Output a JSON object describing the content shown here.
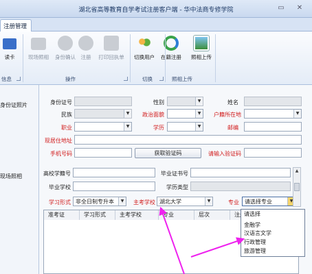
{
  "window": {
    "title": "湖北省高等教育自学考试注册客户端 - 华中法商专修学院",
    "min_glyph": "▭",
    "close_glyph": "✕"
  },
  "tabs": [
    {
      "label": "注册管理"
    }
  ],
  "ribbon": {
    "buttons": [
      {
        "label": "读卡",
        "icon": "id-card-icon",
        "enabled": true
      },
      {
        "label": "现场照相",
        "icon": "camera-icon",
        "enabled": false
      },
      {
        "label": "身份确认",
        "icon": "check-icon",
        "enabled": false
      },
      {
        "label": "注册",
        "icon": "plus-icon",
        "enabled": false
      },
      {
        "label": "打印回执单",
        "icon": "printer-icon",
        "enabled": false
      },
      {
        "label": "切换用户",
        "icon": "users-icon",
        "enabled": true
      },
      {
        "label": "在籍注册",
        "icon": "refresh-icon",
        "enabled": true
      },
      {
        "label": "照相上传",
        "icon": "upload-photo-icon",
        "enabled": true
      }
    ],
    "groups": [
      {
        "label": "信息"
      },
      {
        "label": "操作"
      },
      {
        "label": "切换"
      },
      {
        "label": "照相上传"
      }
    ]
  },
  "left_panel": {
    "id_photo_label": "身份证照片",
    "live_photo_label": "现场照相"
  },
  "form": {
    "id_number": {
      "label": "身份证号",
      "value": ""
    },
    "gender": {
      "label": "性别",
      "value": ""
    },
    "name": {
      "label": "姓名",
      "value": ""
    },
    "ethnicity": {
      "label": "民族",
      "value": ""
    },
    "political_status": {
      "label": "政治面貌",
      "value": ""
    },
    "hukou_location": {
      "label": "户籍所在地",
      "value": ""
    },
    "occupation": {
      "label": "职业",
      "value": ""
    },
    "education": {
      "label": "学历",
      "value": ""
    },
    "postal_code": {
      "label": "邮编",
      "value": ""
    },
    "current_address": {
      "label": "现居住地址",
      "value": ""
    },
    "phone": {
      "label": "手机号码",
      "value": ""
    },
    "get_code_button": {
      "label": "获取验证码"
    },
    "verify_code": {
      "label": "请输入验证码",
      "value": ""
    },
    "college_id": {
      "label": "高校学籍号",
      "value": ""
    },
    "cert_number": {
      "label": "毕业证书号",
      "value": ""
    },
    "school": {
      "label": "毕业学校",
      "value": ""
    },
    "degree_type": {
      "label": "学历类型",
      "value": ""
    },
    "study_form": {
      "label": "学习形式",
      "value": "非全日制专升本"
    },
    "main_school": {
      "label": "主考学校",
      "value": "湖北大学"
    },
    "major": {
      "label": "专业",
      "value": "请选择专业"
    }
  },
  "grid": {
    "columns": [
      "准考证",
      "学习形式",
      "主考学校",
      "专业",
      "层次",
      "注册"
    ]
  },
  "major_dropdown": {
    "options": [
      "请选择",
      "金融学",
      "汉语言文学",
      "行政管理",
      "旅游管理"
    ],
    "highlighted": "请选择"
  },
  "colors": {
    "required_label": "#d11a1a",
    "annotation_arrow": "#ee22ee",
    "ribbon_group_text": "#3a4f72"
  }
}
